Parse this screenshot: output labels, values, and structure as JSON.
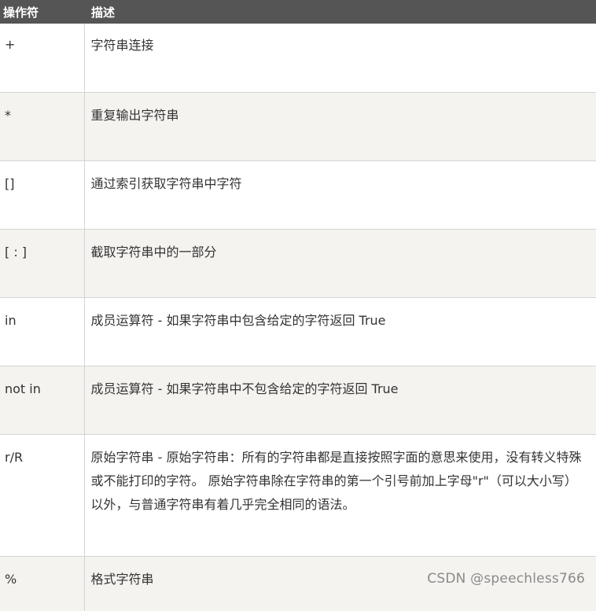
{
  "header": {
    "col_operator": "操作符",
    "col_description": "描述"
  },
  "rows": [
    {
      "op": "+",
      "desc": "字符串连接"
    },
    {
      "op": "*",
      "desc": "重复输出字符串"
    },
    {
      "op": "[]",
      "desc": "通过索引获取字符串中字符"
    },
    {
      "op": "[ : ]",
      "desc": "截取字符串中的一部分"
    },
    {
      "op": "in",
      "desc": "成员运算符 - 如果字符串中包含给定的字符返回 True"
    },
    {
      "op": "not in",
      "desc": "成员运算符 - 如果字符串中不包含给定的字符返回 True"
    },
    {
      "op": "r/R",
      "desc": "原始字符串 - 原始字符串：所有的字符串都是直接按照字面的意思来使用，没有转义特殊或不能打印的字符。 原始字符串除在字符串的第一个引号前加上字母\"r\"（可以大小写）以外，与普通字符串有着几乎完全相同的语法。"
    },
    {
      "op": "%",
      "desc": "格式字符串"
    }
  ],
  "watermark": "CSDN @speechless766",
  "colors": {
    "header_bg": "#555555",
    "header_text": "#ffffff",
    "alt_row_bg": "#f4f3ef",
    "border": "#d4d4d4"
  }
}
